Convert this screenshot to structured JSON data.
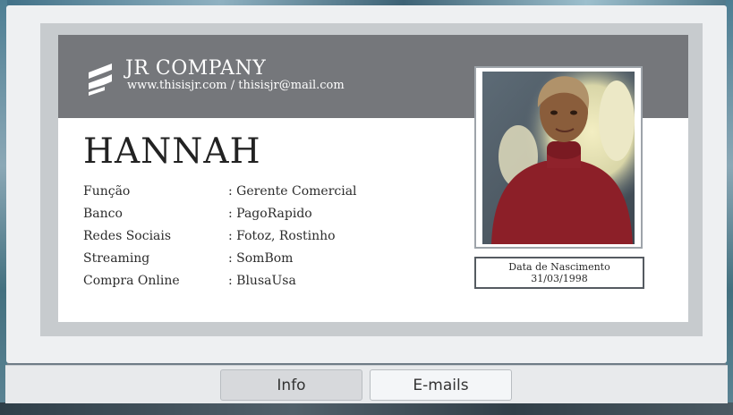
{
  "company": {
    "name": "JR COMPANY",
    "contact": "www.thisisjr.com / thisisjr@mail.com",
    "logo_icon": "jr-logo-icon"
  },
  "profile": {
    "name": "HANNAH",
    "fields": [
      {
        "label": "Função",
        "value": ": Gerente Comercial"
      },
      {
        "label": "Banco",
        "value": ": PagoRapido"
      },
      {
        "label": "Redes Sociais",
        "value": ": Fotoz, Rostinho"
      },
      {
        "label": "Streaming",
        "value": ": SomBom"
      },
      {
        "label": "Compra Online",
        "value": ": BlusaUsa"
      }
    ],
    "dob_label": "Data de Nascimento",
    "dob_value": "31/03/1998"
  },
  "tabs": {
    "info_label": "Info",
    "emails_label": "E-mails"
  },
  "colors": {
    "header": "#75777b",
    "screen_bezel": "#c7cbce",
    "sweater": "#8c1f28"
  }
}
